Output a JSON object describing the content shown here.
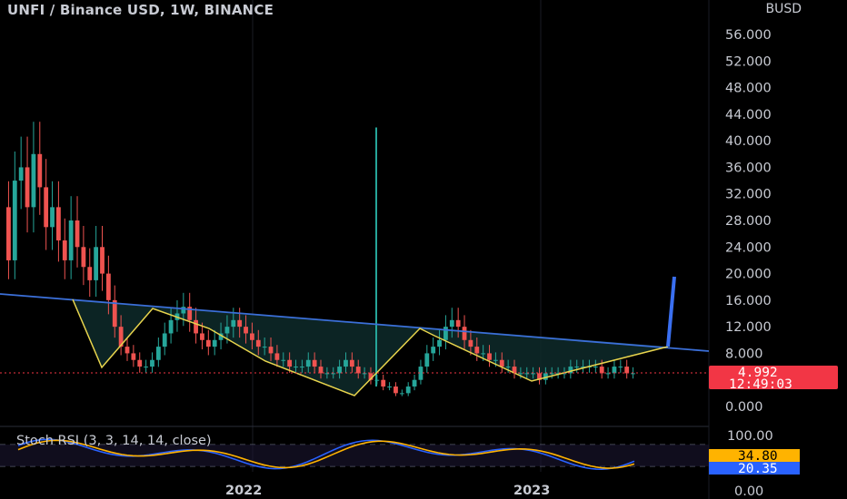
{
  "header": {
    "title": "UNFI / Binance USD, 1W, BINANCE",
    "quote_currency": "BUSD"
  },
  "colors": {
    "background": "#000000",
    "up": "#26a69a",
    "down": "#ef5350",
    "trendline": "#3b6fd8",
    "pattern": "#e8d44d",
    "pattern_fill": "#0e2a2a",
    "price_badge": "#f23645",
    "rsi_k": "#2962ff",
    "rsi_d": "#ffb300",
    "target_arrow": "#3a6ff0"
  },
  "price_axis": {
    "ticks": [
      "56.000",
      "52.000",
      "48.000",
      "44.000",
      "40.000",
      "36.000",
      "32.000",
      "28.000",
      "24.000",
      "20.000",
      "16.000",
      "12.000",
      "8.000",
      "4.000",
      "0.000"
    ],
    "current_price": "4.992",
    "countdown": "12:49:03"
  },
  "time_axis": {
    "labels": [
      "2022",
      "2023"
    ]
  },
  "indicator": {
    "title": "Stoch RSI (3, 3, 14, 14, close)",
    "axis_top": "100.00",
    "axis_bottom": "0.00",
    "k_value": "20.35",
    "d_value": "34.80"
  },
  "chart_data": {
    "type": "candlestick",
    "title": "UNFI / Binance USD, 1W, BINANCE",
    "ylim": [
      -2,
      58
    ],
    "y_ticks": [
      0,
      4,
      8,
      12,
      16,
      20,
      24,
      28,
      32,
      36,
      40,
      44,
      48,
      52,
      56
    ],
    "x_labels": [
      "2022",
      "2023"
    ],
    "candles_approx_close": [
      22,
      34,
      36,
      30,
      38,
      33,
      27,
      30,
      25,
      22,
      28,
      24,
      21,
      19,
      24,
      20,
      16,
      12,
      9,
      8,
      7,
      6,
      6,
      7,
      9,
      11,
      13,
      14,
      15,
      13,
      11,
      10,
      9,
      10,
      11,
      12,
      13,
      12,
      11,
      10,
      9,
      9,
      8,
      7,
      7,
      6,
      6,
      6,
      7,
      6,
      5,
      5,
      5,
      6,
      7,
      6,
      5,
      5,
      4,
      4,
      3,
      3,
      2,
      2,
      3,
      4,
      6,
      8,
      9,
      10,
      12,
      13,
      12,
      10,
      9,
      8,
      8,
      7,
      7,
      6,
      6,
      5,
      5,
      5,
      5,
      4,
      5,
      5,
      5,
      5,
      6,
      6,
      6,
      6,
      6,
      5,
      5,
      6,
      6,
      5,
      5
    ],
    "annotations": {
      "neckline": "descending trendline from ~16.8 to ~8.6",
      "pattern": "inverse head and shoulders",
      "spike_high": 42,
      "target_arrow_top": 19.5
    },
    "stoch_rsi": {
      "k_last": 20.35,
      "d_last": 34.8
    }
  }
}
